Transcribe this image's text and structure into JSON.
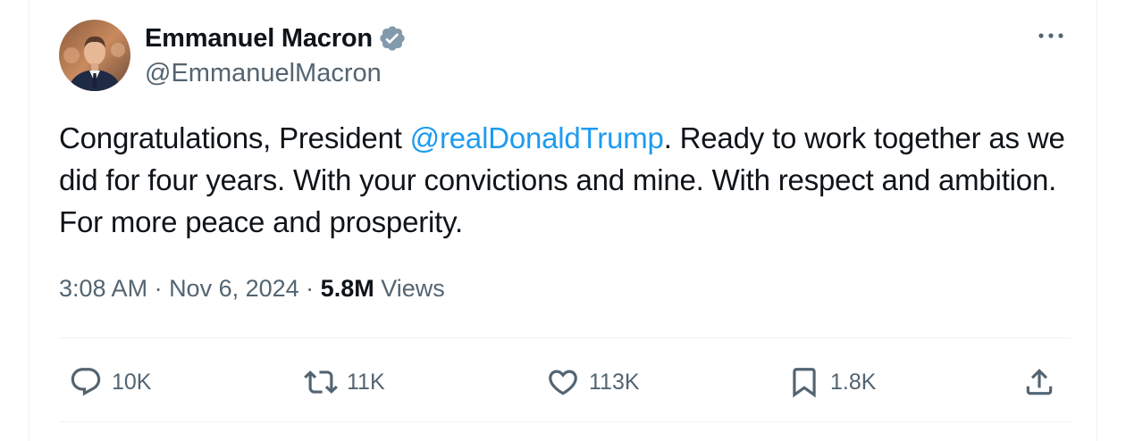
{
  "author": {
    "display_name": "Emmanuel Macron",
    "handle": "@EmmanuelMacron",
    "verified_icon": "verified-badge-icon",
    "verified_color": "#829aab"
  },
  "menu": {
    "more_icon": "more-icon"
  },
  "tweet": {
    "text_before": "Congratulations, President ",
    "mention": "@realDonaldTrump",
    "text_after": ". Ready to work together as we did for four years. With your convictions and mine. With respect and ambition. For more peace and prosperity.",
    "mention_color": "#1d9bf0"
  },
  "meta": {
    "time": "3:08 AM",
    "separator": " · ",
    "date": "Nov 6, 2024",
    "views_count": "5.8M",
    "views_label": " Views"
  },
  "actions": {
    "reply": {
      "icon": "reply-icon",
      "count": "10K"
    },
    "retweet": {
      "icon": "retweet-icon",
      "count": "11K"
    },
    "like": {
      "icon": "heart-icon",
      "count": "113K"
    },
    "bookmark": {
      "icon": "bookmark-icon",
      "count": "1.8K"
    },
    "share": {
      "icon": "share-icon"
    }
  },
  "colors": {
    "text_primary": "#0f1419",
    "text_secondary": "#536471",
    "divider": "#eff3f4"
  }
}
